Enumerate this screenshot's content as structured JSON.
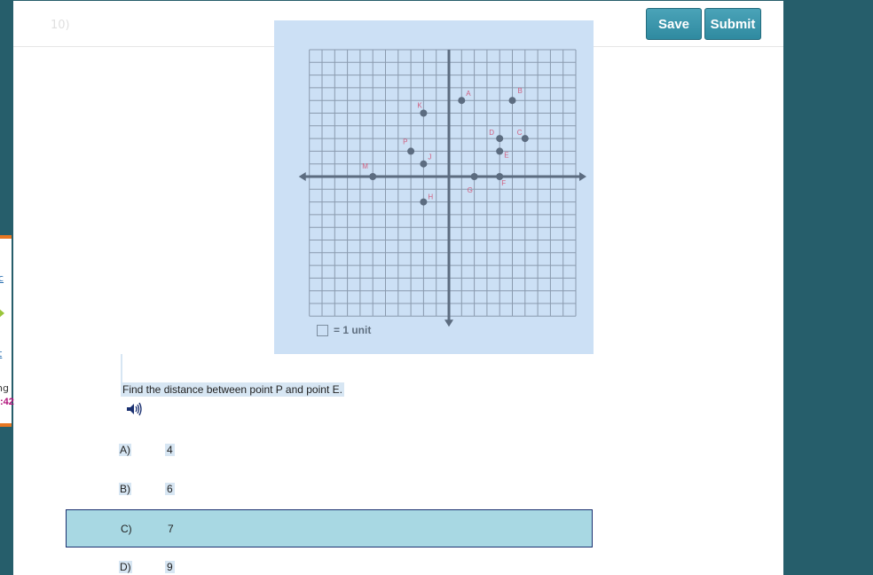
{
  "side_panel": {
    "link1": "c",
    "link2": "t",
    "text": "ng",
    "timer": ":42"
  },
  "header": {
    "question_number": "10)",
    "save_label": "Save",
    "submit_label": "Submit"
  },
  "graph": {
    "legend_text": "= 1 unit",
    "points": [
      {
        "label": "A",
        "x": 1,
        "y": 6
      },
      {
        "label": "B",
        "x": 5,
        "y": 6
      },
      {
        "label": "C",
        "x": 6,
        "y": 3
      },
      {
        "label": "D",
        "x": 4,
        "y": 3
      },
      {
        "label": "E",
        "x": 4,
        "y": 2
      },
      {
        "label": "F",
        "x": 4,
        "y": 0
      },
      {
        "label": "G",
        "x": 2,
        "y": 0
      },
      {
        "label": "H",
        "x": -2,
        "y": -2
      },
      {
        "label": "J",
        "x": -2,
        "y": 1
      },
      {
        "label": "K",
        "x": -2,
        "y": 5
      },
      {
        "label": "M",
        "x": -6,
        "y": 0
      },
      {
        "label": "P",
        "x": -3,
        "y": 2
      }
    ]
  },
  "question": {
    "text": "Find the distance between point P and point E."
  },
  "choices": [
    {
      "letter": "A)",
      "value": "4",
      "selected": false
    },
    {
      "letter": "B)",
      "value": "6",
      "selected": false
    },
    {
      "letter": "C)",
      "value": "7",
      "selected": true
    },
    {
      "letter": "D)",
      "value": "9",
      "selected": false
    }
  ],
  "colors": {
    "teal": "#265e6b",
    "button": "#3a96ad",
    "graph_bg": "#cce0f5",
    "selected": "#a8d8e3",
    "point_label": "#d06080"
  }
}
